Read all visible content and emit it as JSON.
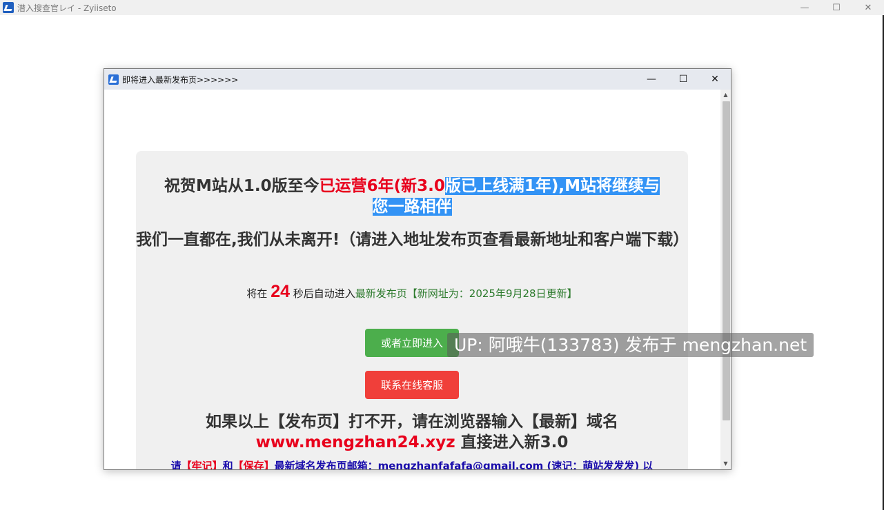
{
  "outer_window": {
    "title": "潜入搜查官レイ - Zyiiseto",
    "minimize": "—",
    "maximize": "☐",
    "close": "✕"
  },
  "dialog": {
    "title": "即将进入最新发布页>>>>>>",
    "minimize": "—",
    "maximize": "☐",
    "close": "✕"
  },
  "content": {
    "heading1_part1": "祝贺M站从1.0版至今",
    "heading1_red": "已运营6年(新3.0",
    "heading1_highlight_a": "版已上线满1年),M站将继续与",
    "heading1_highlight_b": "您一路相伴",
    "heading2": "我们一直都在,我们从未离开!（请进入地址发布页查看最新地址和客户端下载）",
    "countdown_prefix": "将在",
    "countdown_number": "24",
    "countdown_middle": "秒后自动进入",
    "countdown_link": "最新发布页【新网址为：2025年9月28日更新】",
    "enter_button": "或者立即进入",
    "service_button": "联系在线客服",
    "heading3_line1": "如果以上【发布页】打不开，请在浏览器输入【最新】域名",
    "heading3_domain": "www.mengzhan24.xyz",
    "heading3_suffix": " 直接进入新3.0",
    "footer_prefix": "请",
    "footer_red1": "【牢记】",
    "footer_and": "和",
    "footer_red2": "【保存】",
    "footer_rest": "最新域名发布页邮箱：mengzhanfafafa@gmail.com (速记：萌站发发发) 以"
  },
  "watermark": "UP: 阿哦牛(133783) 发布于 mengzhan.net",
  "scrollbar": {
    "up_arrow": "▲",
    "down_arrow": "▼"
  }
}
